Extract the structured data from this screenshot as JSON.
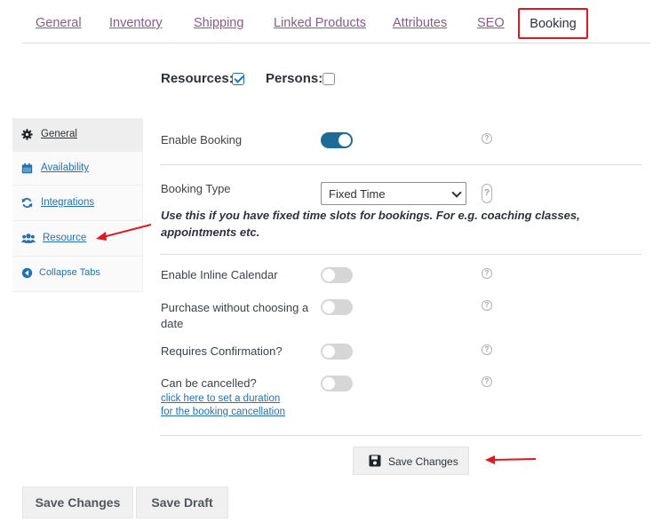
{
  "tabs": [
    {
      "label": "General"
    },
    {
      "label": "Inventory"
    },
    {
      "label": "Shipping"
    },
    {
      "label": "Linked Products"
    },
    {
      "label": "Attributes"
    },
    {
      "label": "SEO"
    },
    {
      "label": "Booking"
    }
  ],
  "options": {
    "resources_label": "Resources:",
    "resources_checked": true,
    "persons_label": "Persons:",
    "persons_checked": false
  },
  "sidebar": {
    "items": [
      {
        "label": "General",
        "icon": "gear-icon",
        "active": true
      },
      {
        "label": "Availability",
        "icon": "calendar-icon"
      },
      {
        "label": "Integrations",
        "icon": "sync-icon"
      },
      {
        "label": "Resource",
        "icon": "users-icon"
      },
      {
        "label": "Collapse Tabs",
        "icon": "collapse-icon"
      }
    ]
  },
  "settings": {
    "enable_booking": {
      "label": "Enable Booking",
      "on": true
    },
    "booking_type": {
      "label": "Booking Type",
      "value": "Fixed Time",
      "hint": "Use this if you have fixed time slots for bookings. For e.g. coaching classes, appointments etc."
    },
    "inline_calendar": {
      "label": "Enable Inline Calendar",
      "on": false
    },
    "purchase_without_date": {
      "label": "Purchase without choosing a date",
      "on": false
    },
    "requires_confirmation": {
      "label": "Requires Confirmation?",
      "on": false
    },
    "can_be_cancelled": {
      "label": "Can be cancelled?",
      "on": false,
      "link": "click here to set a duration for the booking cancellation"
    },
    "help_glyph": "?"
  },
  "buttons": {
    "save_changes_inner": "Save Changes",
    "save_changes": "Save Changes",
    "save_draft": "Save Draft"
  },
  "colors": {
    "accent": "#2271b1",
    "tab_link": "#8a5a86",
    "highlight_red": "#e1171e",
    "toggle_on": "#1e6a98"
  }
}
